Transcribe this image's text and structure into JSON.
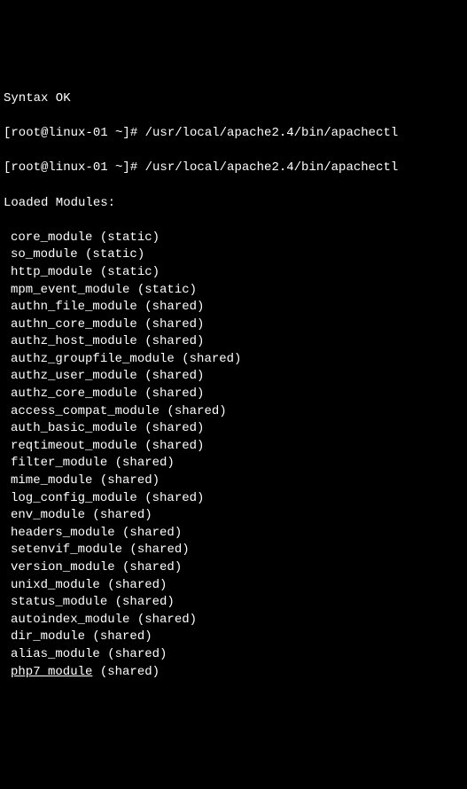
{
  "syntax_ok": "Syntax OK",
  "prompt1": "[root@linux-01 ~]# /usr/local/apache2.4/bin/apachectl",
  "prompt2": "[root@linux-01 ~]# /usr/local/apache2.4/bin/apachectl",
  "loaded_modules_header": "Loaded Modules:",
  "modules": [
    {
      "name": "core_module",
      "type": "static"
    },
    {
      "name": "so_module",
      "type": "static"
    },
    {
      "name": "http_module",
      "type": "static"
    },
    {
      "name": "mpm_event_module",
      "type": "static"
    },
    {
      "name": "authn_file_module",
      "type": "shared"
    },
    {
      "name": "authn_core_module",
      "type": "shared"
    },
    {
      "name": "authz_host_module",
      "type": "shared"
    },
    {
      "name": "authz_groupfile_module",
      "type": "shared"
    },
    {
      "name": "authz_user_module",
      "type": "shared"
    },
    {
      "name": "authz_core_module",
      "type": "shared"
    },
    {
      "name": "access_compat_module",
      "type": "shared"
    },
    {
      "name": "auth_basic_module",
      "type": "shared"
    },
    {
      "name": "reqtimeout_module",
      "type": "shared"
    },
    {
      "name": "filter_module",
      "type": "shared"
    },
    {
      "name": "mime_module",
      "type": "shared"
    },
    {
      "name": "log_config_module",
      "type": "shared"
    },
    {
      "name": "env_module",
      "type": "shared"
    },
    {
      "name": "headers_module",
      "type": "shared"
    },
    {
      "name": "setenvif_module",
      "type": "shared"
    },
    {
      "name": "version_module",
      "type": "shared"
    },
    {
      "name": "unixd_module",
      "type": "shared"
    },
    {
      "name": "status_module",
      "type": "shared"
    },
    {
      "name": "autoindex_module",
      "type": "shared"
    },
    {
      "name": "dir_module",
      "type": "shared"
    },
    {
      "name": "alias_module",
      "type": "shared"
    },
    {
      "name": "php7_module",
      "type": "shared"
    }
  ]
}
